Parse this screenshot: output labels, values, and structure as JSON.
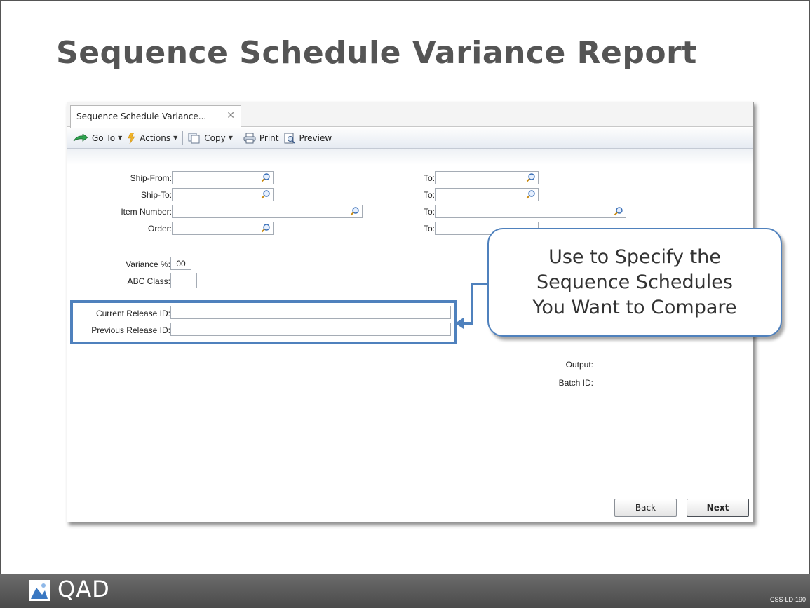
{
  "slide": {
    "title": "Sequence Schedule Variance Report",
    "code": "CSS-LD-190",
    "logo": "QAD"
  },
  "tab": {
    "label": "Sequence Schedule Variance...",
    "close_icon": "close-icon"
  },
  "toolbar": {
    "goto": "Go To",
    "actions": "Actions",
    "copy": "Copy",
    "print": "Print",
    "preview": "Preview"
  },
  "form": {
    "ship_from": {
      "label": "Ship-From:",
      "value": ""
    },
    "ship_from_to": {
      "label": "To:",
      "value": ""
    },
    "ship_to": {
      "label": "Ship-To:",
      "value": ""
    },
    "ship_to_to": {
      "label": "To:",
      "value": ""
    },
    "item_number": {
      "label": "Item Number:",
      "value": ""
    },
    "item_number_to": {
      "label": "To:",
      "value": ""
    },
    "order": {
      "label": "Order:",
      "value": ""
    },
    "order_to": {
      "label": "To:",
      "value": ""
    },
    "variance": {
      "label": "Variance %:",
      "value": "00"
    },
    "abc_class": {
      "label": "ABC Class:",
      "value": ""
    },
    "current_release": {
      "label": "Current Release ID:",
      "value": ""
    },
    "previous_release": {
      "label": "Previous Release ID:",
      "value": ""
    },
    "output": {
      "label": "Output:"
    },
    "batch_id": {
      "label": "Batch ID:"
    }
  },
  "callout": {
    "text": "Use to Specify the\nSequence Schedules\nYou Want to Compare"
  },
  "buttons": {
    "back": "Back",
    "next": "Next"
  },
  "colors": {
    "accent": "#4f81bd",
    "title": "#555555",
    "footer": "#5a5a5a"
  }
}
